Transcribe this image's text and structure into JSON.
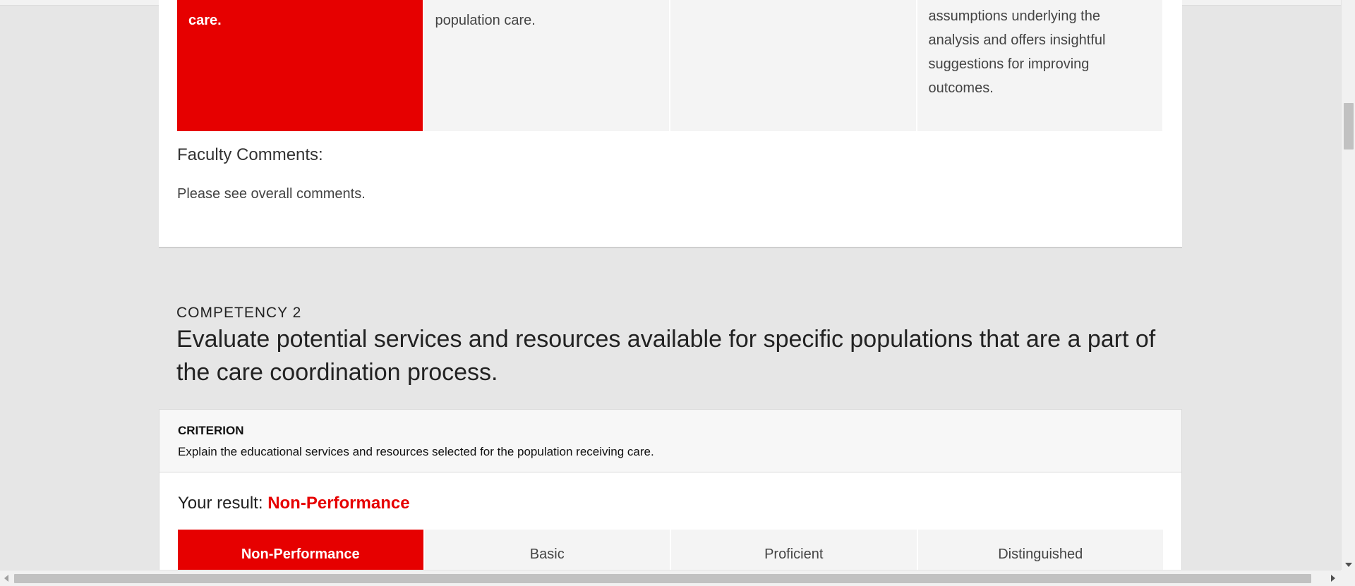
{
  "competency1_remnant": {
    "cells": [
      "care.",
      "population care.",
      "",
      "assumptions underlying the analysis and offers insightful suggestions for improving outcomes."
    ],
    "faculty_comments_label": "Faculty Comments:",
    "faculty_comments_text": "Please see overall comments."
  },
  "competency2": {
    "label": "COMPETENCY 2",
    "title": "Evaluate potential services and resources available for specific populations that are a part of the care coordination process.",
    "criterion_label": "CRITERION",
    "criterion_text": "Explain the educational services and resources selected for the population receiving care.",
    "result_prefix": "Your result:",
    "result_value": "Non-Performance",
    "levels": [
      "Non-Performance",
      "Basic",
      "Proficient",
      "Distinguished"
    ],
    "selected_level_index": 0
  },
  "colors": {
    "accent": "#e60000",
    "page_bg": "#e6e6e6",
    "cell_bg": "#f4f4f4"
  }
}
